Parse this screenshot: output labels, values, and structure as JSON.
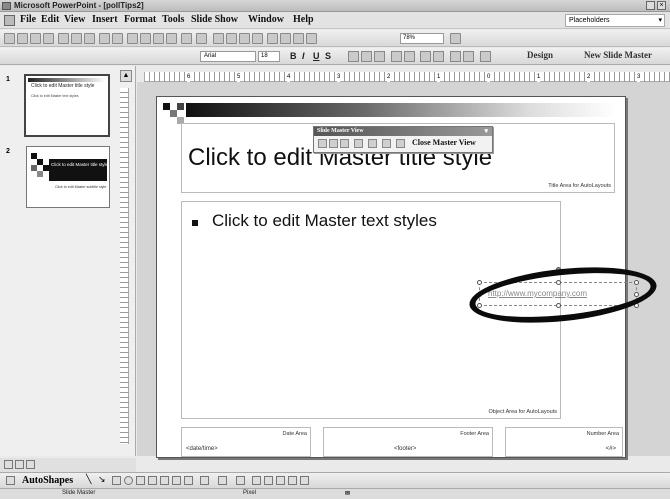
{
  "window": {
    "title": "Microsoft PowerPoint - [pollTips2]"
  },
  "menu": {
    "items": [
      {
        "label": "File"
      },
      {
        "label": "Edit"
      },
      {
        "label": "View"
      },
      {
        "label": "Insert"
      },
      {
        "label": "Format"
      },
      {
        "label": "Tools"
      },
      {
        "label": "Slide Show"
      },
      {
        "label": "Window"
      },
      {
        "label": "Help"
      }
    ],
    "help_box": "Placeholders"
  },
  "standard_toolbar": {
    "zoom": "78%"
  },
  "formatting_toolbar": {
    "font": "Arial",
    "size": "18",
    "bold": "B",
    "italic": "I",
    "underline": "U",
    "shadow": "S",
    "design_label": "Design",
    "new_master_label": "New Slide Master"
  },
  "thumbnails": [
    {
      "number": "1",
      "title": "Click to edit Master title style",
      "body": "Click to edit Master text styles"
    },
    {
      "number": "2",
      "title": "Click to edit Master title style",
      "body": "Click to edit Master subtitle style"
    }
  ],
  "ruler": {
    "labels": [
      "6",
      "5",
      "4",
      "3",
      "2",
      "1",
      "0",
      "1",
      "2",
      "3"
    ]
  },
  "slide": {
    "title": "Click to edit Master title style",
    "title_area_label": "Title Area for AutoLayouts",
    "body": "Click to edit Master text styles",
    "object_area_label": "Object Area for AutoLayouts",
    "link": "http://www.mycompany.com",
    "date_area_label": "Date Area",
    "date_placeholder": "<date/time>",
    "footer_area_label": "Footer Area",
    "footer_placeholder": "<footer>",
    "number_area_label": "Number Area",
    "number_placeholder": "<#>"
  },
  "master_toolbar": {
    "title": "Slide Master View",
    "close_label": "Close Master View"
  },
  "drawing": {
    "autoshapes_label": "AutoShapes"
  },
  "status": {
    "left": "Slide Master",
    "middle": "Pixel"
  }
}
